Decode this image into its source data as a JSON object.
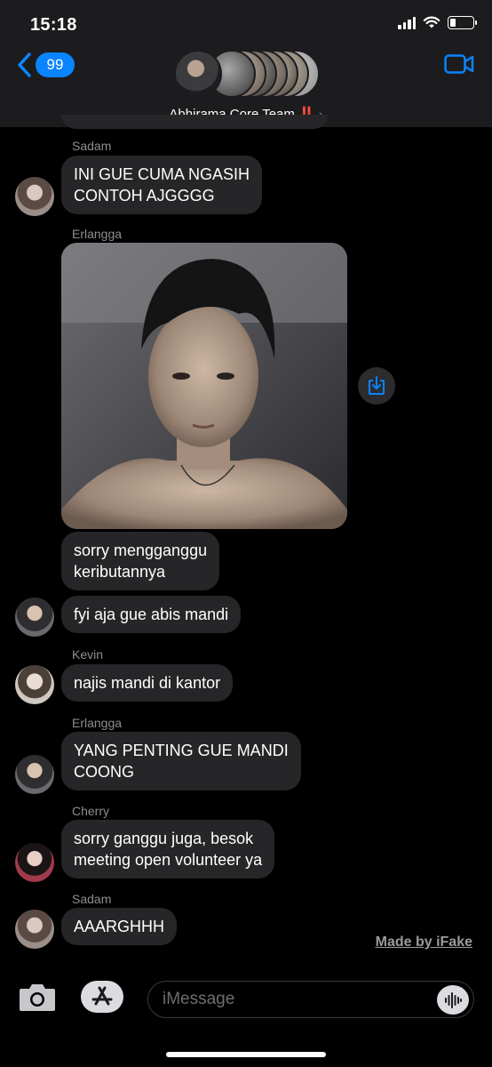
{
  "status_bar": {
    "time": "15:18"
  },
  "header": {
    "back_count": "99",
    "group_name": "Abhirama Core Team",
    "group_emoji": "‼️",
    "chevron": "›"
  },
  "messages": [
    {
      "sender": "Sadam",
      "text": "INI GUE CUMA NGASIH\nCONTOH AJGGGG"
    },
    {
      "sender": "Erlangga",
      "type": "photo"
    },
    {
      "text": "sorry mengganggu\nkeributannya"
    },
    {
      "text": "fyi aja gue abis mandi"
    },
    {
      "sender": "Kevin",
      "text": "najis mandi di kantor"
    },
    {
      "sender": "Erlangga",
      "text": "YANG PENTING GUE MANDI\nCOONG"
    },
    {
      "sender": "Cherry",
      "text": "sorry ganggu juga, besok\nmeeting open volunteer ya"
    },
    {
      "sender": "Sadam",
      "text": "AAARGHHH"
    }
  ],
  "watermark": "Made by iFake",
  "input": {
    "placeholder": "iMessage"
  },
  "colors": {
    "accent": "#0a84ff",
    "bubble": "#262628",
    "header_bg": "#1c1c1e",
    "sender_label": "#8e8e93"
  },
  "icons": {
    "back": "chevron-left-icon",
    "video": "video-camera-icon",
    "save": "download-icon",
    "camera": "camera-icon",
    "apps": "app-store-icon",
    "audio": "waveform-icon"
  }
}
